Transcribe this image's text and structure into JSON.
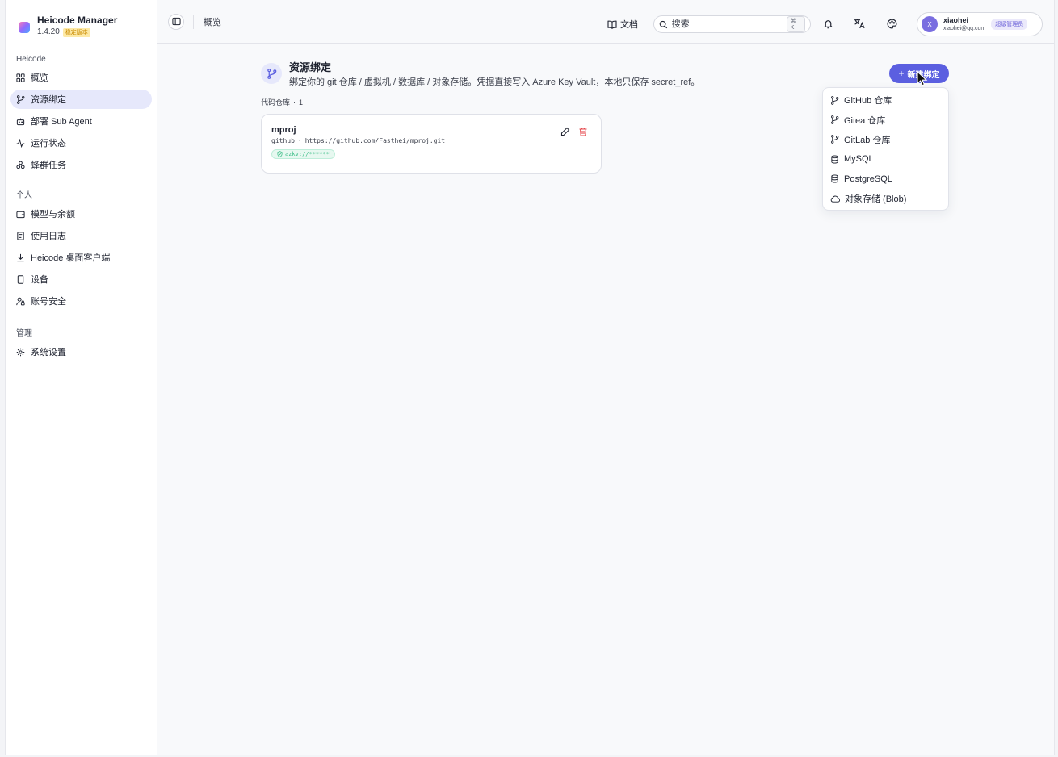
{
  "brand": {
    "title": "Heicode Manager",
    "version": "1.4.20",
    "badge": "稳定版本"
  },
  "sidebar": {
    "sections": [
      {
        "label": "Heicode",
        "items": [
          {
            "label": "概览",
            "icon": "grid-icon"
          },
          {
            "label": "资源绑定",
            "icon": "git-branch-icon",
            "active": true
          },
          {
            "label": "部署 Sub Agent",
            "icon": "bot-icon"
          },
          {
            "label": "运行状态",
            "icon": "activity-icon"
          },
          {
            "label": "蜂群任务",
            "icon": "swarm-icon"
          }
        ]
      },
      {
        "label": "个人",
        "items": [
          {
            "label": "模型与余额",
            "icon": "wallet-icon"
          },
          {
            "label": "使用日志",
            "icon": "log-icon"
          },
          {
            "label": "Heicode 桌面客户端",
            "icon": "download-icon"
          },
          {
            "label": "设备",
            "icon": "device-icon"
          },
          {
            "label": "账号安全",
            "icon": "user-lock-icon"
          }
        ]
      },
      {
        "label": "管理",
        "items": [
          {
            "label": "系统设置",
            "icon": "gear-icon"
          }
        ]
      }
    ]
  },
  "topbar": {
    "breadcrumb": "概览",
    "docs_label": "文档",
    "search_placeholder": "搜索",
    "search_shortcut": "⌘ K",
    "user": {
      "initial": "X",
      "name": "xiaohei",
      "email": "xiaohei@qq.com",
      "role": "超级管理员"
    }
  },
  "page": {
    "title": "资源绑定",
    "description": "绑定你的 git 仓库 / 虚拟机 / 数据库 / 对象存储。凭据直接写入 Azure Key Vault，本地只保存 secret_ref。",
    "add_button": "新建绑定",
    "groups": [
      {
        "label": "代码仓库",
        "count": "1",
        "cards": [
          {
            "name": "mproj",
            "provider": "github",
            "url": "https://github.com/Fasthei/mproj.git",
            "secret": "azkv://******"
          }
        ]
      }
    ]
  },
  "dropdown": {
    "items": [
      {
        "label": "GitHub 仓库",
        "icon": "git-branch-icon"
      },
      {
        "label": "Gitea 仓库",
        "icon": "git-branch-icon"
      },
      {
        "label": "GitLab 仓库",
        "icon": "git-branch-icon"
      },
      {
        "label": "MySQL",
        "icon": "database-icon"
      },
      {
        "label": "PostgreSQL",
        "icon": "database-icon"
      },
      {
        "label": "对象存储 (Blob)",
        "icon": "cloud-icon"
      }
    ]
  },
  "colors": {
    "accent": "#5b5fe0",
    "active_bg": "#e6e8fb",
    "danger": "#e5484d",
    "secret": "#3fbf8a"
  }
}
